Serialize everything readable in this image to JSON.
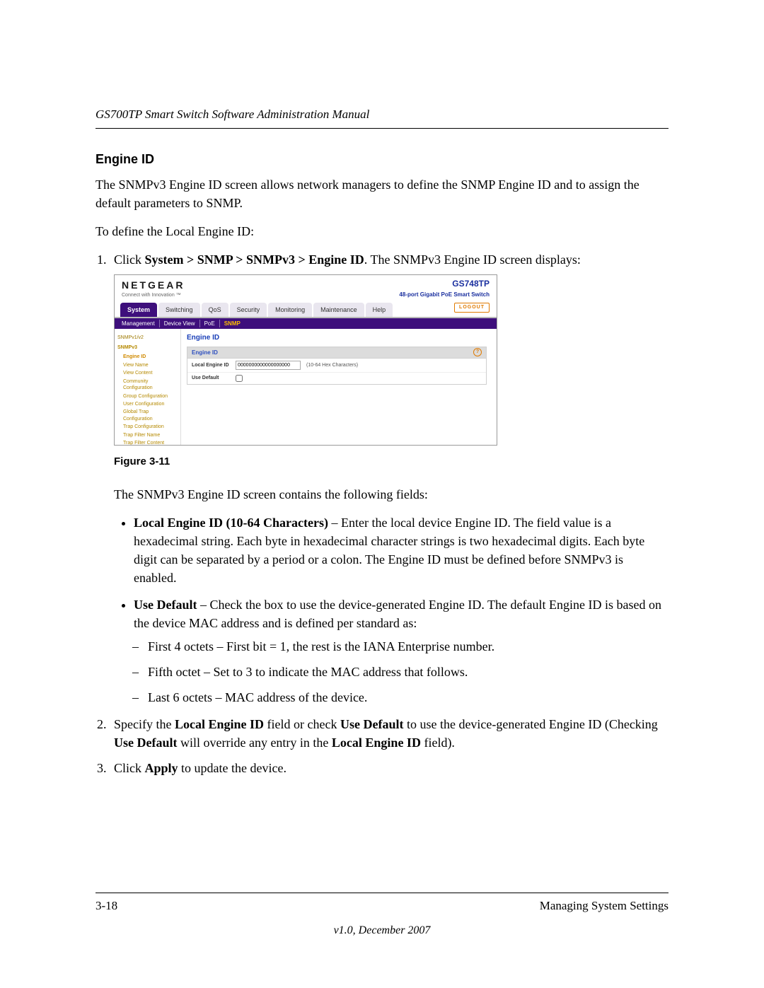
{
  "header": {
    "running": "GS700TP Smart Switch Software Administration Manual"
  },
  "section": {
    "title": "Engine ID",
    "intro": "The SNMPv3 Engine ID screen allows network managers to define the SNMP Engine ID and to assign the default parameters to SNMP.",
    "lead": "To define the Local Engine ID:",
    "step1_a": "Click ",
    "step1_b": "System > SNMP > SNMPv3 > Engine ID",
    "step1_c": ". The SNMPv3 Engine ID screen displays:",
    "fig_caption": "Figure 3-11",
    "after_fig": "The SNMPv3 Engine ID screen contains the following fields:",
    "b1_label": "Local Engine ID (10-64 Characters)",
    "b1_text": " – Enter the local device Engine ID. The field value is a hexadecimal string. Each byte in hexadecimal character strings is two hexadecimal digits. Each byte digit can be separated by a period or a colon. The Engine ID must be defined before SNMPv3 is enabled.",
    "b2_label": "Use Default",
    "b2_text": " – Check the box to use the device-generated Engine ID. The default Engine ID is based on the device MAC address and is defined per standard as:",
    "sub1": "First 4 octets – First bit = 1, the rest is the IANA Enterprise number.",
    "sub2": "Fifth octet – Set to 3 to indicate the MAC address that follows.",
    "sub3": "Last 6 octets – MAC address of the device.",
    "step2_a": "Specify the ",
    "step2_b": "Local Engine ID",
    "step2_c": " field or check ",
    "step2_d": "Use Default",
    "step2_e": " to use the device-generated Engine ID (Checking ",
    "step2_f": "Use Default",
    "step2_g": " will override any entry in the ",
    "step2_h": "Local Engine ID",
    "step2_i": " field).",
    "step3_a": "Click ",
    "step3_b": "Apply",
    "step3_c": " to update the device."
  },
  "shot": {
    "brand": "NETGEAR",
    "brand_tag": "Connect with Innovation ™",
    "model": "GS748TP",
    "model_sub": "48-port Gigabit PoE Smart Switch",
    "tabs": [
      "System",
      "Switching",
      "QoS",
      "Security",
      "Monitoring",
      "Maintenance",
      "Help"
    ],
    "logout": "LOGOUT",
    "subtabs": [
      "Management",
      "Device View",
      "PoE",
      "SNMP"
    ],
    "side_top": "SNMPv1/v2",
    "side_group": "SNMPv3",
    "side_items": [
      "Engine ID",
      "View Name",
      "View Content",
      "Community Configuration",
      "Group Configuration",
      "User Configuration",
      "Global Trap Configuration",
      "Trap Configuration",
      "Trap Filter Name",
      "Trap Filter Content"
    ],
    "panel_title": "Engine ID",
    "panel_head": "Engine ID",
    "row1_label": "Local Engine ID",
    "row1_value": "0000000000000000000",
    "row1_hint": "(10-64 Hex Characters)",
    "row2_label": "Use Default"
  },
  "footer": {
    "left": "3-18",
    "right": "Managing System Settings",
    "version": "v1.0, December 2007"
  }
}
